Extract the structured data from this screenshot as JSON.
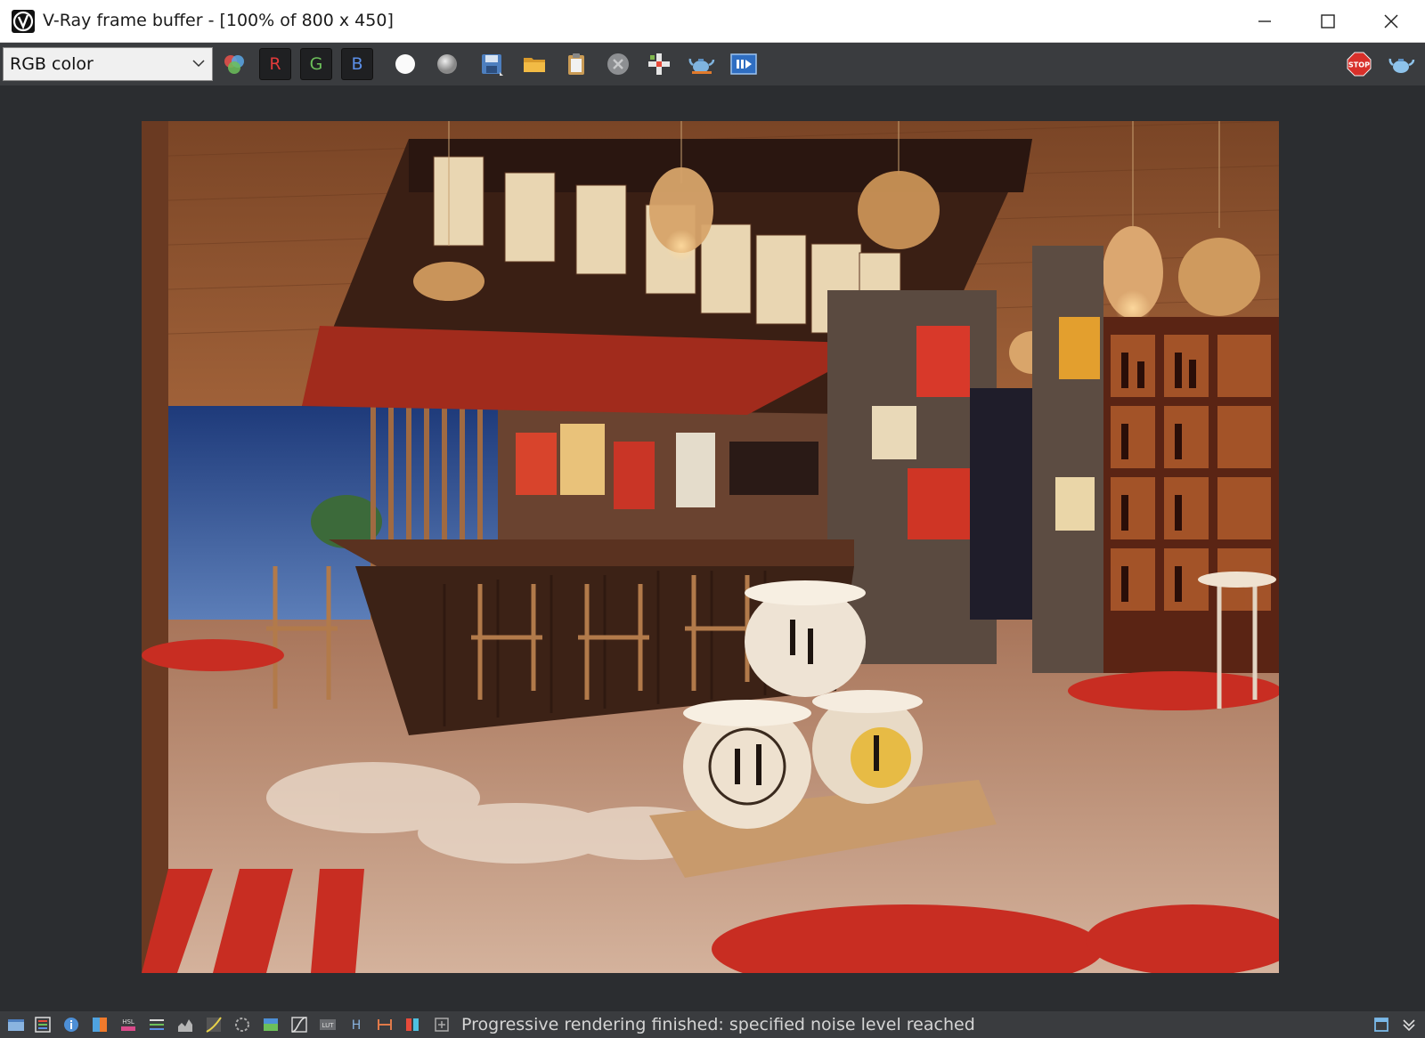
{
  "window": {
    "title": "V-Ray frame buffer - [100% of 800 x 450]",
    "controls": [
      "minimize-icon",
      "maximize-icon",
      "close-icon"
    ]
  },
  "toolbar": {
    "channel_select": {
      "value": "RGB color",
      "options_visible": [
        "RGB color"
      ]
    },
    "channel_buttons": {
      "r": "R",
      "g": "G",
      "b": "B"
    },
    "channel_colors": {
      "r": "#e03a3a",
      "g": "#6cbf5a",
      "b": "#5b8fe8"
    },
    "icons": [
      "rgb-channels-icon",
      "mono-white-icon",
      "mono-gray-icon",
      "save-image-icon",
      "open-image-icon",
      "clipboard-icon",
      "clear-image-icon",
      "track-mouse-icon",
      "render-teapot-icon",
      "region-render-icon",
      "stop-render-icon",
      "render-icon"
    ]
  },
  "render": {
    "description_icons": [
      "render-image"
    ],
    "accent_red": "#c7261b",
    "wood": "#8a5232"
  },
  "statusbar": {
    "message": "Progressive rendering finished: specified noise level reached",
    "icons": [
      "history-icon",
      "layers-icon",
      "info-icon",
      "color-correction-icon",
      "hsl-icon",
      "levels-icon",
      "histogram-icon",
      "curves-icon",
      "exposure-icon",
      "background-icon",
      "curve-icon",
      "lut-icon",
      "hue-icon",
      "range-icon",
      "compare-icon",
      "settings-icon",
      "dock-icon",
      "expand-icon"
    ]
  }
}
